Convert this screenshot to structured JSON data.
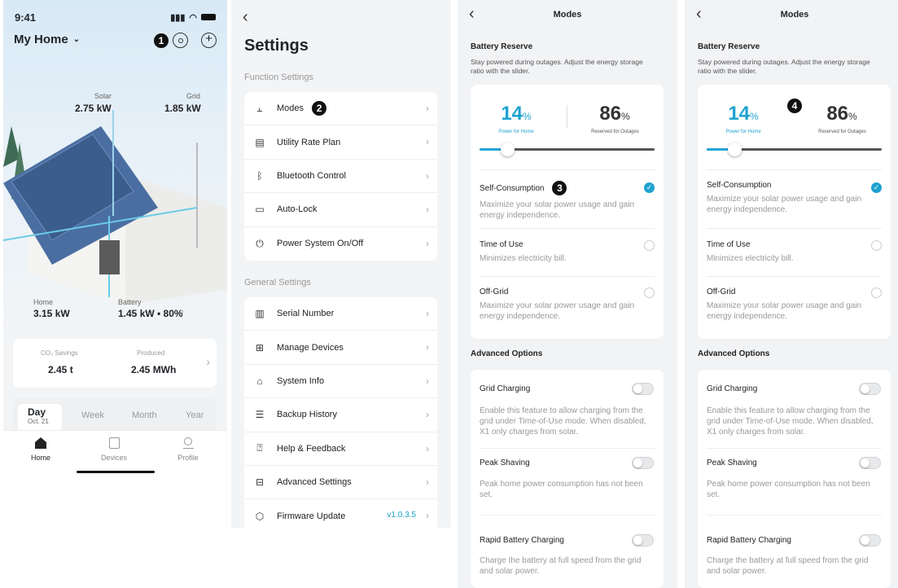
{
  "home": {
    "time": "9:41",
    "title": "My Home",
    "callout": "1",
    "solar": {
      "label": "Solar",
      "value": "2.75 kW"
    },
    "grid": {
      "label": "Grid",
      "value": "1.85 kW"
    },
    "home_power": {
      "label": "Home",
      "value": "3.15 kW"
    },
    "battery": {
      "label": "Battery",
      "value": "1.45 kW • 80%"
    },
    "stats": {
      "co2_label": "CO₂ Savings",
      "co2_value": "2.45 t",
      "produced_label": "Produced",
      "produced_value": "2.45 MWh"
    },
    "periods": {
      "day": "Day",
      "day_date": "Oct. 21",
      "week": "Week",
      "month": "Month",
      "year": "Year"
    },
    "tabs": {
      "home": "Home",
      "devices": "Devices",
      "profile": "Profile"
    },
    "icons": [
      "settings-icon",
      "add-icon",
      "chevron-down-icon",
      "signal-icon",
      "wifi-icon",
      "battery-icon"
    ]
  },
  "settings": {
    "title": "Settings",
    "function_label": "Function Settings",
    "general_label": "General Settings",
    "callout": "2",
    "function_items": [
      {
        "label": "Modes"
      },
      {
        "label": "Utility Rate Plan"
      },
      {
        "label": "Bluetooth Control"
      },
      {
        "label": "Auto-Lock"
      },
      {
        "label": "Power System On/Off"
      }
    ],
    "general_items": [
      {
        "label": "Serial Number"
      },
      {
        "label": "Manage Devices"
      },
      {
        "label": "System Info"
      },
      {
        "label": "Backup History"
      },
      {
        "label": "Help & Feedback"
      },
      {
        "label": "Advanced Settings"
      },
      {
        "label": "Firmware Update",
        "value": "v1.0.3.5"
      }
    ]
  },
  "modes": {
    "title": "Modes",
    "reserve_title": "Battery Reserve",
    "reserve_desc": "Stay powered during outages. Adjust the energy storage ratio with the slider.",
    "home_pct": "14",
    "outage_pct": "86",
    "pct_unit": "%",
    "home_pct_label": "Power for Home",
    "outage_pct_label": "Reserved for Outages",
    "slider_fraction": 0.14,
    "options": [
      {
        "title": "Self-Consumption",
        "desc": "Maximize your solar power usage and gain energy independence.",
        "selected": true
      },
      {
        "title": "Time of Use",
        "desc": "Minimizes electricity bill.",
        "selected": false
      },
      {
        "title": "Off-Grid",
        "desc": "Maximize your solar power usage and gain energy independence.",
        "selected": false
      }
    ],
    "advanced_title": "Advanced Options",
    "advanced": [
      {
        "title": "Grid Charging",
        "desc": "Enable this feature to allow charging from the grid under Time-of-Use mode. When disabled, X1 only charges from solar."
      },
      {
        "title": "Peak Shaving",
        "desc": "Peak home power consumption has not been set."
      },
      {
        "title": "Rapid Battery Charging",
        "desc": "Charge the battery at full speed from the grid and solar power."
      }
    ],
    "callout_3": "3",
    "callout_4": "4",
    "accent_color": "#1ea2cf"
  }
}
